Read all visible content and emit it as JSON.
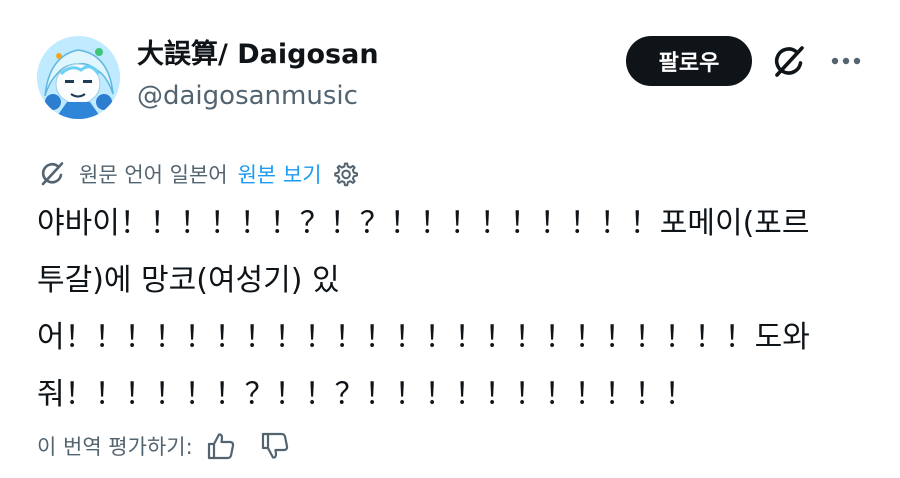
{
  "author": {
    "display_name": "大誤算/ Daigosan",
    "handle": "@daigosanmusic",
    "avatar_icon": "anime-avatar-image"
  },
  "actions": {
    "follow_label": "팔로우",
    "grok_icon": "grok-icon",
    "more_icon": "more-icon"
  },
  "translation": {
    "source_text": "원문 언어 일본어",
    "view_original_label": "원본 보기",
    "settings_icon": "gear-icon"
  },
  "tweet": {
    "lines": [
      "야바이！！！！！！？！？！！！！！！！！！포메이(포르",
      "투갈)에 망코(여성기) 있",
      "어！！！！！！！！！！！！！！！！！！！！！！！도와",
      "줘！！！！！！？！！？！！！！！！！！！！！"
    ]
  },
  "rating": {
    "label": "이 번역 평가하기:",
    "thumbs_up_icon": "thumbs-up-icon",
    "thumbs_down_icon": "thumbs-down-icon"
  },
  "colors": {
    "text_primary": "#0f1419",
    "text_secondary": "#536471",
    "link": "#1d9bf0",
    "follow_button_bg": "#0f1419",
    "follow_button_text": "#ffffff"
  }
}
